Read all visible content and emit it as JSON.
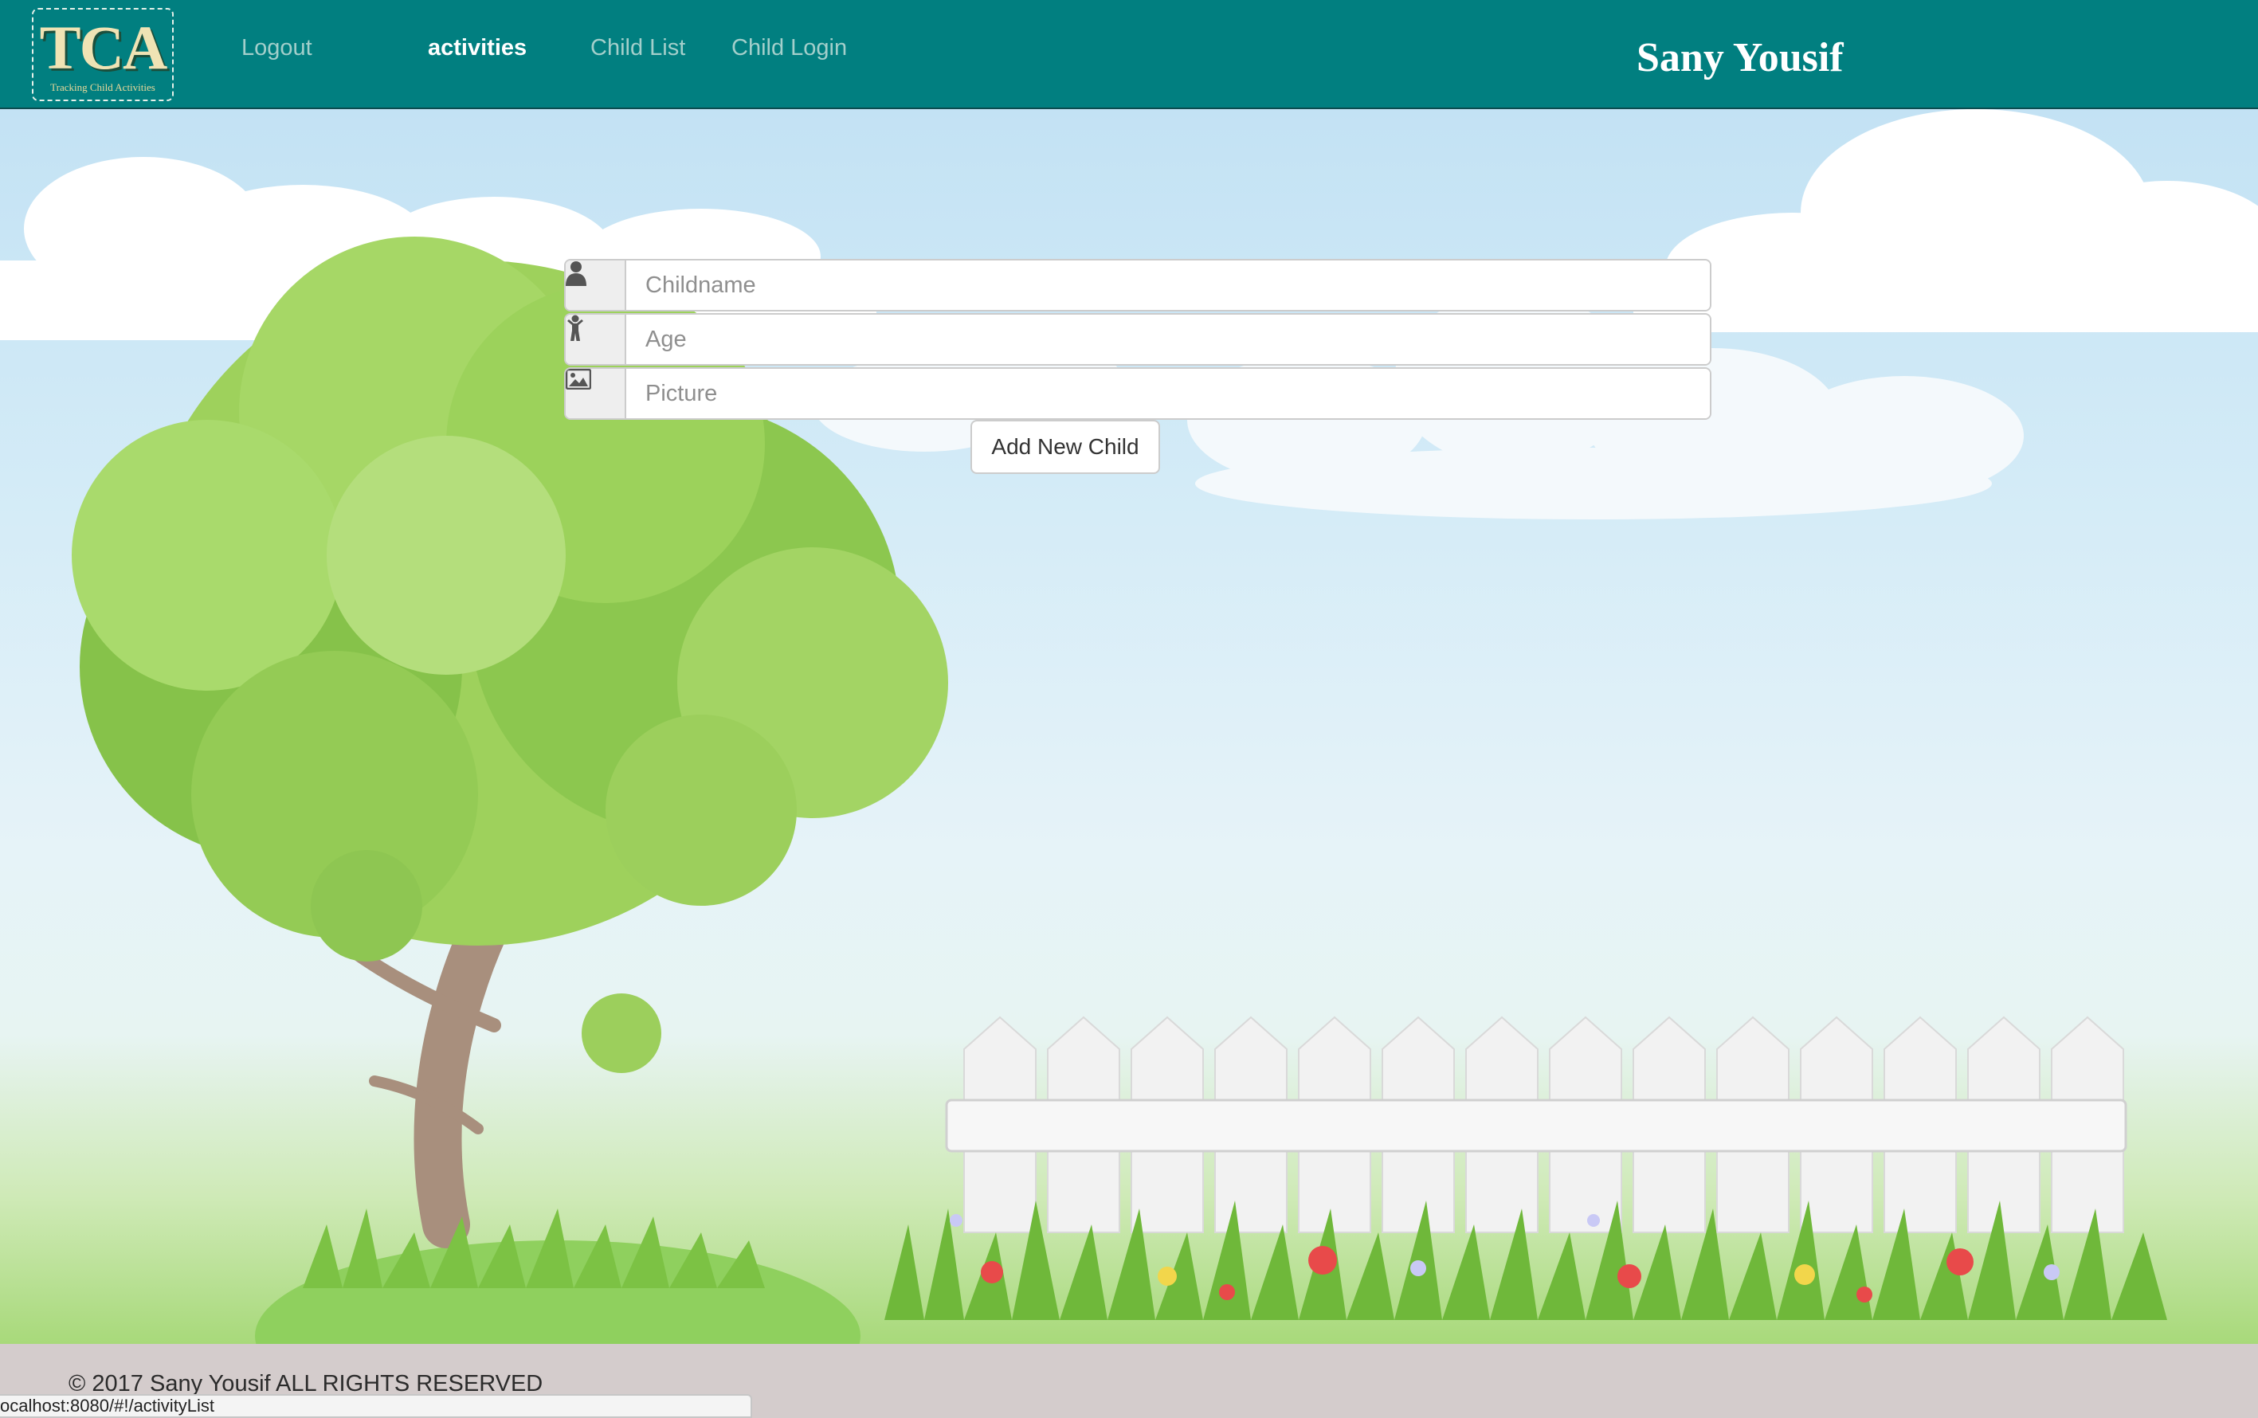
{
  "navbar": {
    "logo_text": "TCA",
    "logo_subtitle": "Tracking Child Activities",
    "links": [
      {
        "label": "Logout",
        "active": false
      },
      {
        "label": "activities",
        "active": true
      },
      {
        "label": "Child List",
        "active": false
      },
      {
        "label": "Child Login",
        "active": false
      }
    ],
    "user_name": "Sany Yousif",
    "background_color": "#017f80"
  },
  "form": {
    "fields": [
      {
        "icon": "user-icon",
        "placeholder": "Childname",
        "value": ""
      },
      {
        "icon": "child-icon",
        "placeholder": "Age",
        "value": ""
      },
      {
        "icon": "picture-icon",
        "placeholder": "Picture",
        "value": ""
      }
    ],
    "submit_label": "Add New Child"
  },
  "footer": {
    "text": "© 2017 Sany Yousif ALL RIGHTS RESERVED"
  },
  "status_bar": {
    "url": "ocalhost:8080/#!/activityList"
  }
}
